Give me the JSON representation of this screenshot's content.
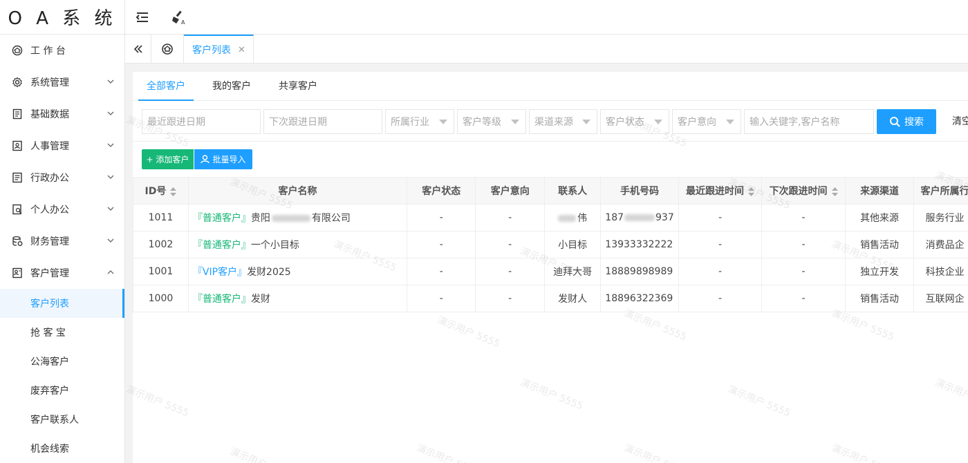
{
  "app": {
    "logo": "O A 系 统"
  },
  "sidebar": {
    "items": [
      {
        "label": "工 作 台",
        "icon": "dashboard-icon",
        "expandable": false
      },
      {
        "label": "系统管理",
        "icon": "settings-icon",
        "expandable": true
      },
      {
        "label": "基础数据",
        "icon": "database-icon",
        "expandable": true
      },
      {
        "label": "人事管理",
        "icon": "user-card-icon",
        "expandable": true
      },
      {
        "label": "行政办公",
        "icon": "document-icon",
        "expandable": true
      },
      {
        "label": "个人办公",
        "icon": "user-search-icon",
        "expandable": true
      },
      {
        "label": "财务管理",
        "icon": "finance-icon",
        "expandable": true
      },
      {
        "label": "客户管理",
        "icon": "customer-icon",
        "expandable": true,
        "expanded": true
      }
    ],
    "sub_items": [
      {
        "label": "客户列表",
        "active": true
      },
      {
        "label": "抢 客 宝",
        "active": false
      },
      {
        "label": "公海客户",
        "active": false
      },
      {
        "label": "废弃客户",
        "active": false
      },
      {
        "label": "客户联系人",
        "active": false
      },
      {
        "label": "机会线索",
        "active": false
      }
    ]
  },
  "tabs": {
    "active_label": "客户列表",
    "close_glyph": "✕"
  },
  "subtabs": [
    "全部客户",
    "我的客户",
    "共享客户"
  ],
  "filters": {
    "last_follow_placeholder": "最近跟进日期",
    "next_follow_placeholder": "下次跟进日期",
    "industry": "所属行业",
    "grade": "客户等级",
    "source": "渠道来源",
    "status": "客户状态",
    "intent": "客户意向",
    "keyword_placeholder": "输入关键字,客户名称",
    "search_label": "搜索",
    "clear_label": "清空"
  },
  "actions": {
    "add_label": "+ 添加客户",
    "import_label": "批量导入"
  },
  "table": {
    "headers": [
      "ID号",
      "客户名称",
      "客户状态",
      "客户意向",
      "联系人",
      "手机号码",
      "最近跟进时间",
      "下次跟进时间",
      "来源渠道",
      "客户所属行"
    ],
    "rows": [
      {
        "id": "1011",
        "tag": "『普通客户』",
        "tag_type": "normal",
        "name_pre": "贵阳",
        "name_post": "有限公司",
        "status": "-",
        "intent": "-",
        "contact_post": "伟",
        "phone_pre": "187",
        "phone_post": "937",
        "last": "-",
        "next": "-",
        "source": "其他来源",
        "industry": "服务行业"
      },
      {
        "id": "1002",
        "tag": "『普通客户』",
        "tag_type": "normal",
        "name_pre": "一个小目标",
        "name_post": "",
        "status": "-",
        "intent": "-",
        "contact_post": "小目标",
        "phone_pre": "13933332222",
        "phone_post": "",
        "last": "-",
        "next": "-",
        "source": "销售活动",
        "industry": "消费品企"
      },
      {
        "id": "1001",
        "tag": "『VIP客户』",
        "tag_type": "vip",
        "name_pre": "发财2025",
        "name_post": "",
        "status": "-",
        "intent": "-",
        "contact_post": "迪拜大哥",
        "phone_pre": "18889898989",
        "phone_post": "",
        "last": "-",
        "next": "-",
        "source": "独立开发",
        "industry": "科技企业"
      },
      {
        "id": "1000",
        "tag": "『普通客户』",
        "tag_type": "normal",
        "name_pre": "发财",
        "name_post": "",
        "status": "-",
        "intent": "-",
        "contact_post": "发财人",
        "phone_pre": "18896322369",
        "phone_post": "",
        "last": "-",
        "next": "-",
        "source": "销售活动",
        "industry": "互联网企"
      }
    ]
  },
  "watermark": "演示用户 5555",
  "colors": {
    "primary": "#1e9fff",
    "success": "#16b777"
  }
}
